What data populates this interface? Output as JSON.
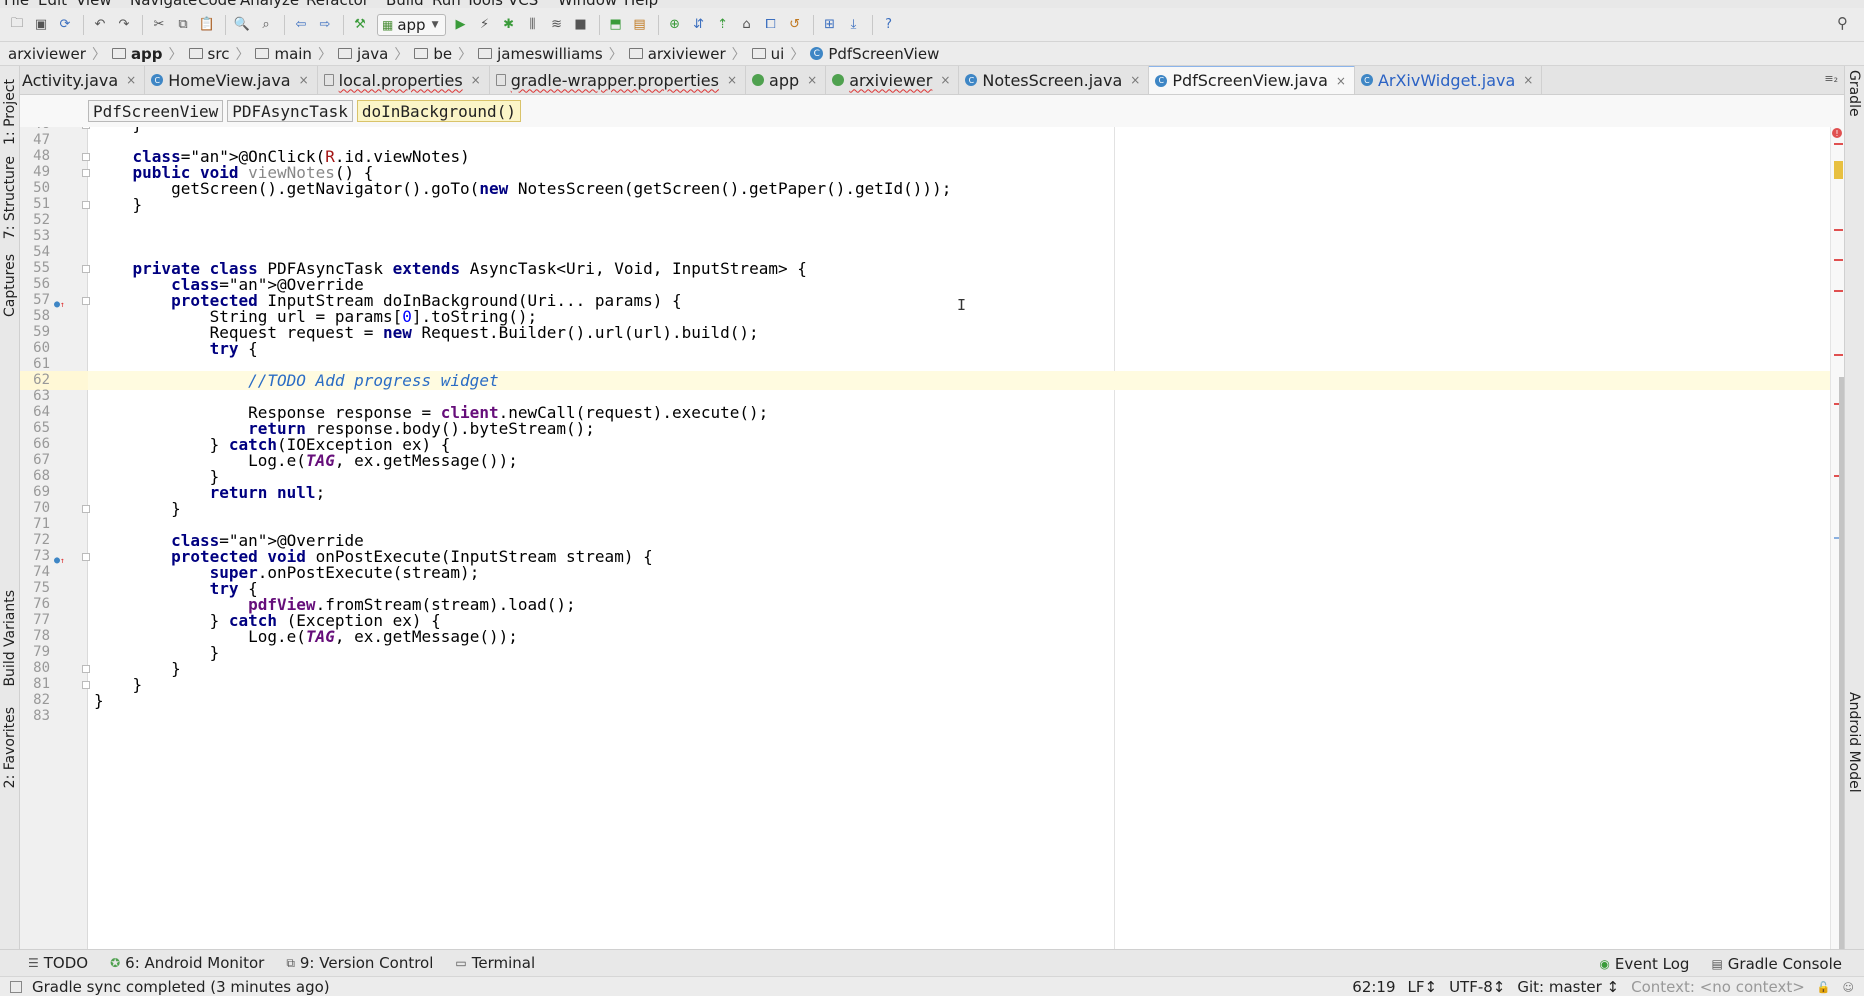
{
  "menubar": {
    "items": [
      "File",
      "Edit",
      "View",
      "Navigate",
      "Code",
      "Analyze",
      "Refactor",
      "Build",
      "Run",
      "Tools",
      "VCS",
      "Window",
      "Help"
    ]
  },
  "toolbar": {
    "run_config": "app"
  },
  "breadcrumb": [
    "arxiviewer",
    "app",
    "src",
    "main",
    "java",
    "be",
    "jameswilliams",
    "arxiviewer",
    "ui",
    "PdfScreenView"
  ],
  "tabs": [
    {
      "label": "Activity.java",
      "icon": "none"
    },
    {
      "label": "HomeView.java",
      "icon": "class-icon"
    },
    {
      "label": "local.properties",
      "icon": "file-icon"
    },
    {
      "label": "gradle-wrapper.properties",
      "icon": "file-icon"
    },
    {
      "label": "app",
      "icon": "module-icon"
    },
    {
      "label": "arxiviewer",
      "icon": "module-icon"
    },
    {
      "label": "NotesScreen.java",
      "icon": "class-icon"
    },
    {
      "label": "PdfScreenView.java",
      "icon": "class-icon",
      "active": true
    },
    {
      "label": "ArXivWidget.java",
      "icon": "class-icon"
    }
  ],
  "structure": [
    "PdfScreenView",
    "PDFAsyncTask",
    "doInBackground()"
  ],
  "left_tools": [
    "1: Project",
    "7: Structure",
    "Captures",
    "Build Variants",
    "2: Favorites"
  ],
  "right_tools": [
    "Gradle",
    "Android Model"
  ],
  "code": {
    "first_line": 46,
    "lines": [
      "        }",
      "",
      "        @OnClick(R.id.viewNotes)",
      "        public void viewNotes() {",
      "            getScreen().getNavigator().goTo(new NotesScreen(getScreen().getPaper().getId()));",
      "        }",
      "",
      "",
      "",
      "        private class PDFAsyncTask extends AsyncTask<Uri, Void, InputStream> {",
      "            @Override",
      "            protected InputStream doInBackground(Uri... params) {",
      "                String url = params[0].toString();",
      "                Request request = new Request.Builder().url(url).build();",
      "                try {",
      "",
      "                    //TODO Add progress widget",
      "",
      "                    Response response = client.newCall(request).execute();",
      "                    return response.body().byteStream();",
      "                } catch(IOException ex) {",
      "                    Log.e(TAG, ex.getMessage());",
      "                }",
      "                return null;",
      "            }",
      "",
      "            @Override",
      "            protected void onPostExecute(InputStream stream) {",
      "                super.onPostExecute(stream);",
      "                try {",
      "                    pdfView.fromStream(stream).load();",
      "                } catch (Exception ex) {",
      "                    Log.e(TAG, ex.getMessage());",
      "                }",
      "            }",
      "        }",
      "    }",
      ""
    ],
    "caret_line": 62
  },
  "bottom_tools": {
    "todo": "TODO",
    "android_monitor": "6: Android Monitor",
    "version_control": "9: Version Control",
    "terminal": "Terminal",
    "event_log": "Event Log",
    "gradle_console": "Gradle Console"
  },
  "status": {
    "message": "Gradle sync completed (3 minutes ago)",
    "position": "62:19",
    "line_sep": "LF↕",
    "encoding": "UTF-8↕",
    "git": "Git: master ↕",
    "context": "Context: <no context>"
  }
}
